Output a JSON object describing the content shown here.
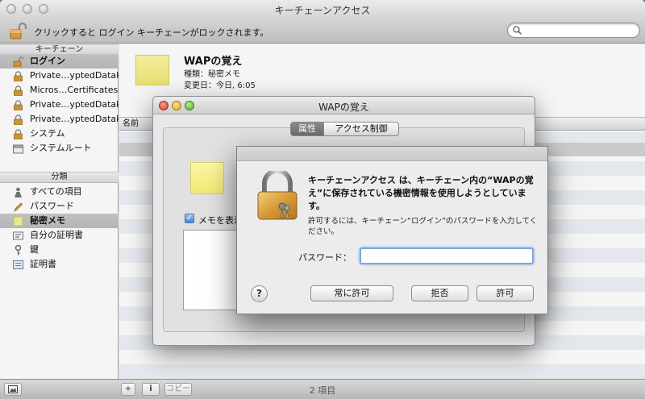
{
  "window": {
    "title": "キーチェーンアクセス"
  },
  "toolbar": {
    "lock_message": "クリックすると ログイン キーチェーンがロックされます。",
    "search_placeholder": ""
  },
  "sidebar": {
    "keychains_header": "キーチェーン",
    "keychains": [
      {
        "label": "ログイン",
        "icon": "lock-open-icon",
        "selected": true
      },
      {
        "label": "Private…yptedDatak",
        "icon": "lock-icon",
        "selected": false
      },
      {
        "label": "Micros…Certificates",
        "icon": "lock-icon",
        "selected": false
      },
      {
        "label": "Private…yptedDatak",
        "icon": "lock-icon",
        "selected": false
      },
      {
        "label": "Private…yptedDatak",
        "icon": "lock-icon",
        "selected": false
      },
      {
        "label": "システム",
        "icon": "lock-icon",
        "selected": false
      },
      {
        "label": "システムルート",
        "icon": "folder-icon",
        "selected": false
      }
    ],
    "category_header": "分類",
    "categories": [
      {
        "label": "すべての項目",
        "icon": "people-icon",
        "selected": false
      },
      {
        "label": "パスワード",
        "icon": "pen-icon",
        "selected": false
      },
      {
        "label": "秘密メモ",
        "icon": "note-icon",
        "selected": true
      },
      {
        "label": "自分の証明書",
        "icon": "card-icon",
        "selected": false
      },
      {
        "label": "鍵",
        "icon": "key-icon",
        "selected": false
      },
      {
        "label": "証明書",
        "icon": "certificate-icon",
        "selected": false
      }
    ]
  },
  "detail": {
    "title": "WAPの覚え",
    "kind": "種類：秘密メモ",
    "modified": "変更日：今日, 6:05"
  },
  "list": {
    "name_header": "名前"
  },
  "bottombar": {
    "copy_label": "コピー",
    "item_count": "2 項目"
  },
  "subwindow": {
    "title": "WAPの覚え",
    "tab_attributes": "属性",
    "tab_access": "アクセス制御",
    "show_memo_label": "メモを表示",
    "show_memo_checked": true
  },
  "dialog": {
    "message": "キーチェーンアクセス は、キーチェーン内の“WAPの覚え”に保存されている機密情報を使用しようとしています。",
    "submessage": "許可するには、キーチェーン“ログイン”のパスワードを入力してください。",
    "password_label": "パスワード：",
    "password_value": "",
    "help_label": "?",
    "always_allow_label": "常に許可",
    "deny_label": "拒否",
    "allow_label": "許可"
  }
}
